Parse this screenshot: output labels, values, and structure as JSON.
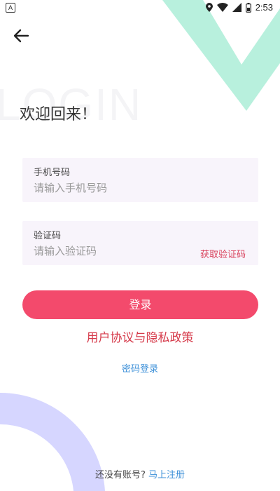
{
  "status_bar": {
    "time": "2:53",
    "left_icon": "app-notification-icon",
    "right_icons": [
      "location-icon",
      "wifi-icon",
      "cellular-icon",
      "battery-icon"
    ]
  },
  "header": {
    "back_icon": "arrow-left-icon",
    "background_word": "LOGIN",
    "welcome_text": "欢迎回来！"
  },
  "form": {
    "phone": {
      "label": "手机号码",
      "placeholder": "请输入手机号码",
      "value": ""
    },
    "code": {
      "label": "验证码",
      "placeholder": "请输入验证码",
      "value": "",
      "get_code_label": "获取验证码"
    }
  },
  "actions": {
    "login_label": "登录",
    "agreement_label": "用户协议与隐私政策",
    "password_login_label": "密码登录"
  },
  "footer": {
    "no_account_text": "还没有账号?",
    "register_label": "马上注册"
  },
  "colors": {
    "primary": "#f34a6c",
    "agreement": "#d63b4b",
    "link": "#3b8fd8",
    "field_bg": "#f8f4fb",
    "deco_green": "#b8f0dd",
    "deco_purple": "#d6d6ff"
  }
}
